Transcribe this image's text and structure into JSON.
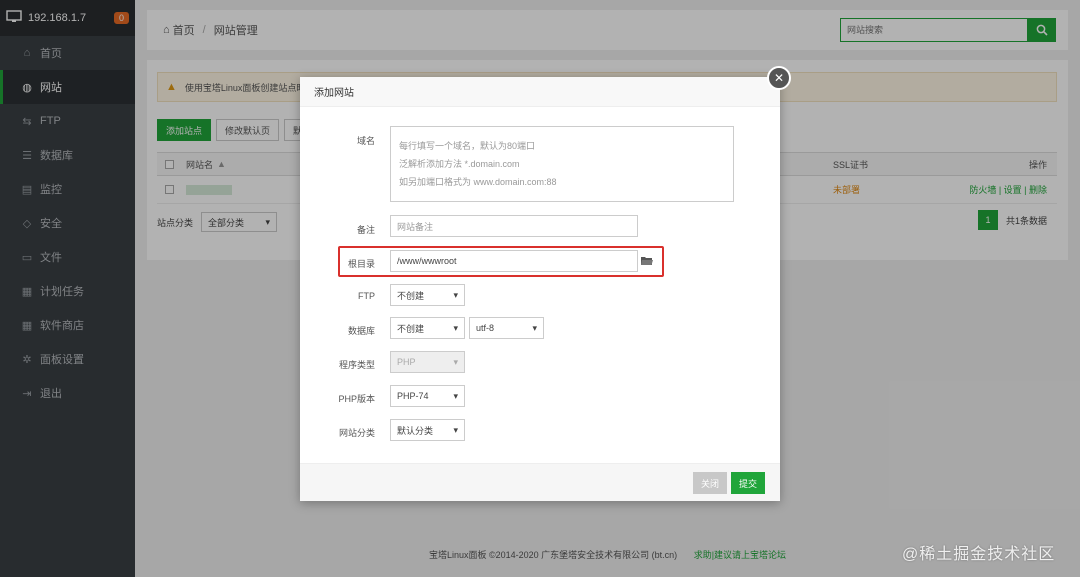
{
  "sidebar": {
    "server_ip": "192.168.1.7",
    "badge_count": "0",
    "items": [
      {
        "label": "首页",
        "icon": "home-icon"
      },
      {
        "label": "网站",
        "icon": "globe-icon"
      },
      {
        "label": "FTP",
        "icon": "ftp-icon"
      },
      {
        "label": "数据库",
        "icon": "database-icon"
      },
      {
        "label": "监控",
        "icon": "monitor-icon"
      },
      {
        "label": "安全",
        "icon": "shield-icon"
      },
      {
        "label": "文件",
        "icon": "folder-icon"
      },
      {
        "label": "计划任务",
        "icon": "calendar-icon"
      },
      {
        "label": "软件商店",
        "icon": "grid-icon"
      },
      {
        "label": "面板设置",
        "icon": "gear-icon"
      },
      {
        "label": "退出",
        "icon": "logout-icon"
      }
    ],
    "active_index": 1
  },
  "header": {
    "breadcrumb_home": "首页",
    "breadcrumb_sep": "/",
    "breadcrumb_current": "网站管理",
    "search_placeholder": "网站搜索"
  },
  "page": {
    "notice": "使用宝塔Linux面板创建站点时",
    "buttons": {
      "add_site": "添加站点",
      "edit_default": "修改默认页",
      "default_site": "默"
    },
    "table": {
      "col_site": "网站名",
      "col_ssl": "SSL证书",
      "col_ops": "操作",
      "row": {
        "ssl": "未部署",
        "ops": "防火墙 | 设置 | 删除"
      }
    },
    "category_label": "站点分类",
    "category_value": "全部分类",
    "page_number": "1",
    "total": "共1条数据"
  },
  "modal": {
    "title": "添加网站",
    "domain_label": "域名",
    "domain_placeholder_lines": [
      "每行填写一个域名，默认为80端口",
      "泛解析添加方法 *.domain.com",
      "如另加端口格式为 www.domain.com:88"
    ],
    "remark_label": "备注",
    "remark_placeholder": "网站备注",
    "root_label": "根目录",
    "root_value": "/www/wwwroot",
    "ftp_label": "FTP",
    "ftp_value": "不创建",
    "db_label": "数据库",
    "db_value": "不创建",
    "db_charset": "utf-8",
    "program_label": "程序类型",
    "program_value": "PHP",
    "php_version_label": "PHP版本",
    "php_version_value": "PHP-74",
    "category_label": "网站分类",
    "category_value": "默认分类",
    "cancel_label": "关闭",
    "submit_label": "提交"
  },
  "footer": {
    "copyright": "宝塔Linux面板 ©2014-2020 广东堡塔安全技术有限公司 (bt.cn)",
    "link": "求助|建议请上宝塔论坛"
  },
  "watermark": "@稀土掘金技术社区",
  "colors": {
    "accent": "#20a53a",
    "sidebar_bg": "#3a3f44",
    "highlight": "#d9302c",
    "warning": "#e08a15"
  }
}
